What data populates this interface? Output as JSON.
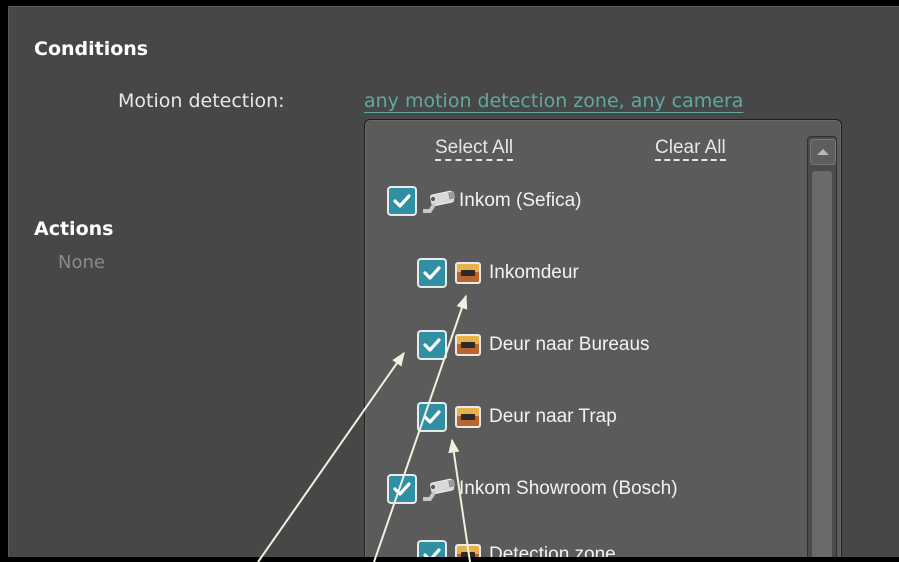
{
  "conditions": {
    "title": "Conditions",
    "motion_label": "Motion detection:",
    "motion_value": "any motion detection zone, any camera"
  },
  "actions": {
    "title": "Actions",
    "none": "None"
  },
  "dropdown": {
    "select_all": "Select All",
    "clear_all": "Clear All",
    "items": [
      {
        "label": "Inkom (Sefica)",
        "type": "camera",
        "checked": true
      },
      {
        "label": "Inkomdeur",
        "type": "zone",
        "checked": true
      },
      {
        "label": "Deur naar Bureaus",
        "type": "zone",
        "checked": true
      },
      {
        "label": "Deur naar Trap",
        "type": "zone",
        "checked": true
      },
      {
        "label": "Inkom Showroom (Bosch)",
        "type": "camera",
        "checked": true
      },
      {
        "label": "Detection zone",
        "type": "zone",
        "checked": true
      }
    ]
  },
  "colors": {
    "accent_link": "#5fa9a0",
    "checkbox_fill": "#2f8fa3",
    "panel_bg": "#474747",
    "dropdown_bg": "#5b5b5b"
  },
  "icons": [
    "check-icon",
    "camera-icon",
    "zone-icon",
    "scroll-up-icon"
  ]
}
